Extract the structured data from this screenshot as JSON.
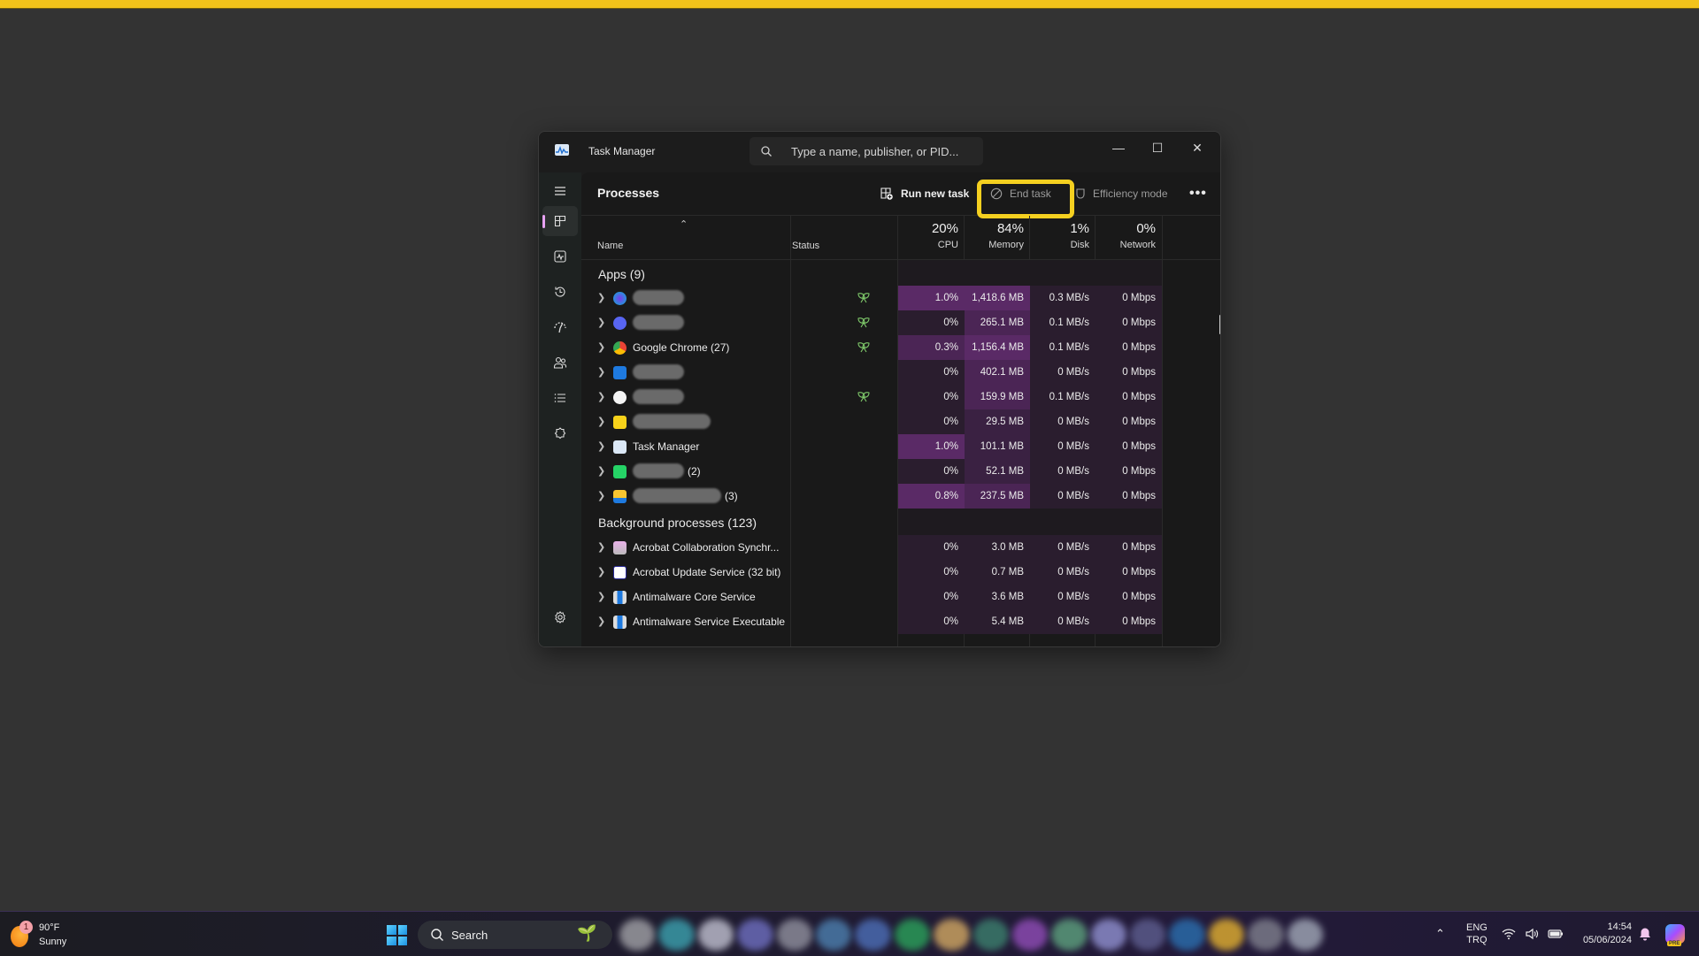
{
  "window": {
    "title": "Task Manager",
    "search_placeholder": "Type a name, publisher, or PID...",
    "controls": {
      "minimize": "—",
      "maximize": "☐",
      "close": "✕"
    }
  },
  "sidebar": {
    "items": [
      {
        "name": "hamburger-menu",
        "active": false
      },
      {
        "name": "processes",
        "active": true
      },
      {
        "name": "performance",
        "active": false
      },
      {
        "name": "app-history",
        "active": false
      },
      {
        "name": "startup-apps",
        "active": false
      },
      {
        "name": "users",
        "active": false
      },
      {
        "name": "details",
        "active": false
      },
      {
        "name": "services",
        "active": false
      }
    ],
    "settings": "settings"
  },
  "commandbar": {
    "page_title": "Processes",
    "run_new_task": "Run new task",
    "end_task": "End task",
    "efficiency_mode": "Efficiency mode",
    "more": "•••",
    "highlight_color": "#f5d020"
  },
  "table": {
    "columns": {
      "name": "Name",
      "status": "Status",
      "cpu": {
        "label": "CPU",
        "total": "20%"
      },
      "memory": {
        "label": "Memory",
        "total": "84%"
      },
      "disk": {
        "label": "Disk",
        "total": "1%"
      },
      "network": {
        "label": "Network",
        "total": "0%"
      }
    },
    "groups": {
      "apps": "Apps (9)",
      "background": "Background processes (123)"
    },
    "apps": [
      {
        "name": "",
        "suffix": "",
        "redacted": true,
        "icon": "canva-icon",
        "efficiency": true,
        "cpu": "1.0%",
        "memory": "1,418.6 MB",
        "disk": "0.3 MB/s",
        "network": "0 Mbps"
      },
      {
        "name": "",
        "suffix": "",
        "redacted": true,
        "icon": "discord-icon",
        "efficiency": true,
        "cpu": "0%",
        "memory": "265.1 MB",
        "disk": "0.1 MB/s",
        "network": "0 Mbps"
      },
      {
        "name": "Google Chrome (27)",
        "suffix": "",
        "redacted": false,
        "icon": "chrome-icon",
        "efficiency": true,
        "cpu": "0.3%",
        "memory": "1,156.4 MB",
        "disk": "0.1 MB/s",
        "network": "0 Mbps"
      },
      {
        "name": "",
        "suffix": "",
        "redacted": true,
        "icon": "pcloud-icon",
        "efficiency": false,
        "cpu": "0%",
        "memory": "402.1 MB",
        "disk": "0 MB/s",
        "network": "0 Mbps"
      },
      {
        "name": "",
        "suffix": "",
        "redacted": true,
        "icon": "spotify-icon",
        "efficiency": true,
        "cpu": "0%",
        "memory": "159.9 MB",
        "disk": "0.1 MB/s",
        "network": "0 Mbps"
      },
      {
        "name": "",
        "suffix": "",
        "redacted": true,
        "icon": "sticky-notes-icon",
        "efficiency": false,
        "cpu": "0%",
        "memory": "29.5 MB",
        "disk": "0 MB/s",
        "network": "0 Mbps"
      },
      {
        "name": "Task Manager",
        "suffix": "",
        "redacted": false,
        "icon": "task-manager-icon",
        "efficiency": false,
        "cpu": "1.0%",
        "memory": "101.1 MB",
        "disk": "0 MB/s",
        "network": "0 Mbps"
      },
      {
        "name": "",
        "suffix": "(2)",
        "redacted": true,
        "icon": "whatsapp-icon",
        "efficiency": false,
        "cpu": "0%",
        "memory": "52.1 MB",
        "disk": "0 MB/s",
        "network": "0 Mbps"
      },
      {
        "name": "",
        "suffix": "(3)",
        "redacted": true,
        "icon": "file-explorer-icon",
        "efficiency": false,
        "cpu": "0.8%",
        "memory": "237.5 MB",
        "disk": "0 MB/s",
        "network": "0 Mbps"
      }
    ],
    "background": [
      {
        "name": "Acrobat Collaboration Synchr...",
        "icon": "acrobat-sync-icon",
        "cpu": "0%",
        "memory": "3.0 MB",
        "disk": "0 MB/s",
        "network": "0 Mbps"
      },
      {
        "name": "Acrobat Update Service (32 bit)",
        "icon": "acrobat-update-icon",
        "cpu": "0%",
        "memory": "0.7 MB",
        "disk": "0 MB/s",
        "network": "0 Mbps"
      },
      {
        "name": "Antimalware Core Service",
        "icon": "antimalware-icon",
        "cpu": "0%",
        "memory": "3.6 MB",
        "disk": "0 MB/s",
        "network": "0 Mbps"
      },
      {
        "name": "Antimalware Service Executable",
        "icon": "antimalware-icon",
        "cpu": "0%",
        "memory": "5.4 MB",
        "disk": "0 MB/s",
        "network": "0 Mbps"
      }
    ]
  },
  "taskbar": {
    "weather": {
      "temp": "90°F",
      "condition": "Sunny",
      "badge": "1"
    },
    "search_label": "Search",
    "tray": {
      "lang_top": "ENG",
      "lang_bottom": "TRQ",
      "time": "14:54",
      "date": "05/06/2024",
      "copilot_badge": "PRE"
    }
  }
}
